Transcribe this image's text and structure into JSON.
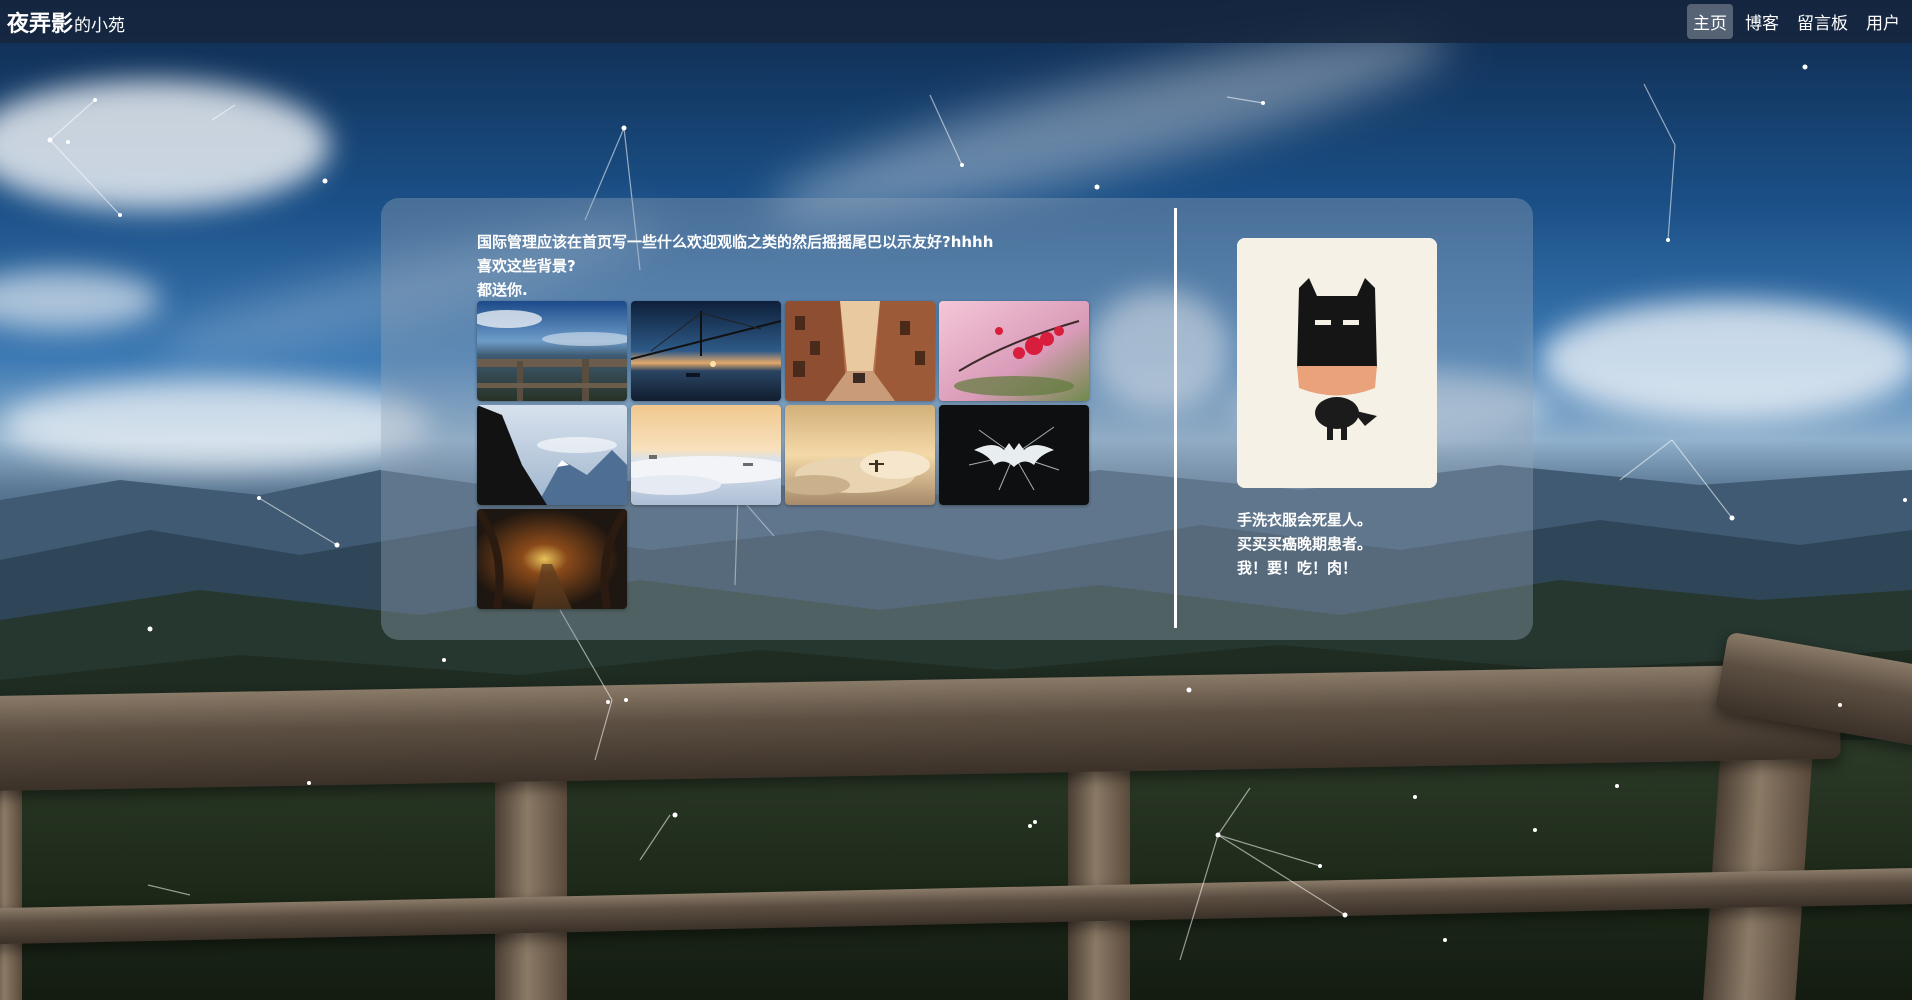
{
  "site": {
    "brand_name": "夜弄影",
    "brand_suffix": "的小苑"
  },
  "nav": {
    "items": [
      {
        "label": "主页",
        "active": true
      },
      {
        "label": "博客",
        "active": false
      },
      {
        "label": "留言板",
        "active": false
      },
      {
        "label": "用户",
        "active": false
      }
    ]
  },
  "intro": {
    "lines": [
      "国际管理应该在首页写一些什么欢迎观临之类的然后摇摇尾巴以示友好?hhhh",
      "喜欢这些背景?",
      "都送你."
    ]
  },
  "gallery": {
    "thumbnails": [
      {
        "name": "mountain-fence-sky"
      },
      {
        "name": "bridge-sunset-sea"
      },
      {
        "name": "old-town-street"
      },
      {
        "name": "pink-blossom"
      },
      {
        "name": "snowy-mountain-cliff"
      },
      {
        "name": "sea-of-clouds-dawn"
      },
      {
        "name": "christ-statue-clouds"
      },
      {
        "name": "dark-bat-logo"
      },
      {
        "name": "forest-tunnel-path"
      }
    ]
  },
  "profile": {
    "avatar_icon": "batman-illustration",
    "motto_lines": [
      "手洗衣服会死星人。",
      "买买买癌晚期患者。",
      "我！要！吃！肉！"
    ]
  },
  "colors": {
    "topbar": "#16263e",
    "panel": "rgba(150,165,185,0.38)",
    "text": "#ffffff"
  }
}
